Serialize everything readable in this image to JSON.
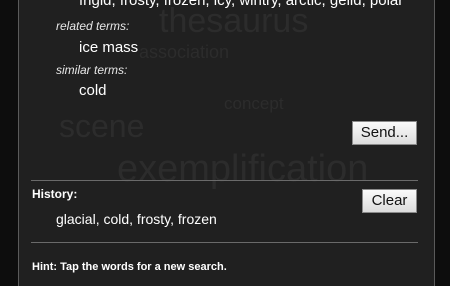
{
  "background_words": [
    "thesaurus",
    "association",
    "concept",
    "scene",
    "exemplification"
  ],
  "synonyms_line": "frigid, frosty, frozen, icy, wintry, arctic, gelid, polar",
  "related": {
    "label": "related terms:",
    "terms": "ice mass"
  },
  "similar": {
    "label": "similar terms:",
    "terms": "cold"
  },
  "send_label": "Send...",
  "history": {
    "label": "History:",
    "items": "glacial, cold, frosty, frozen",
    "clear_label": "Clear"
  },
  "hint": "Hint: Tap the words for a new search."
}
